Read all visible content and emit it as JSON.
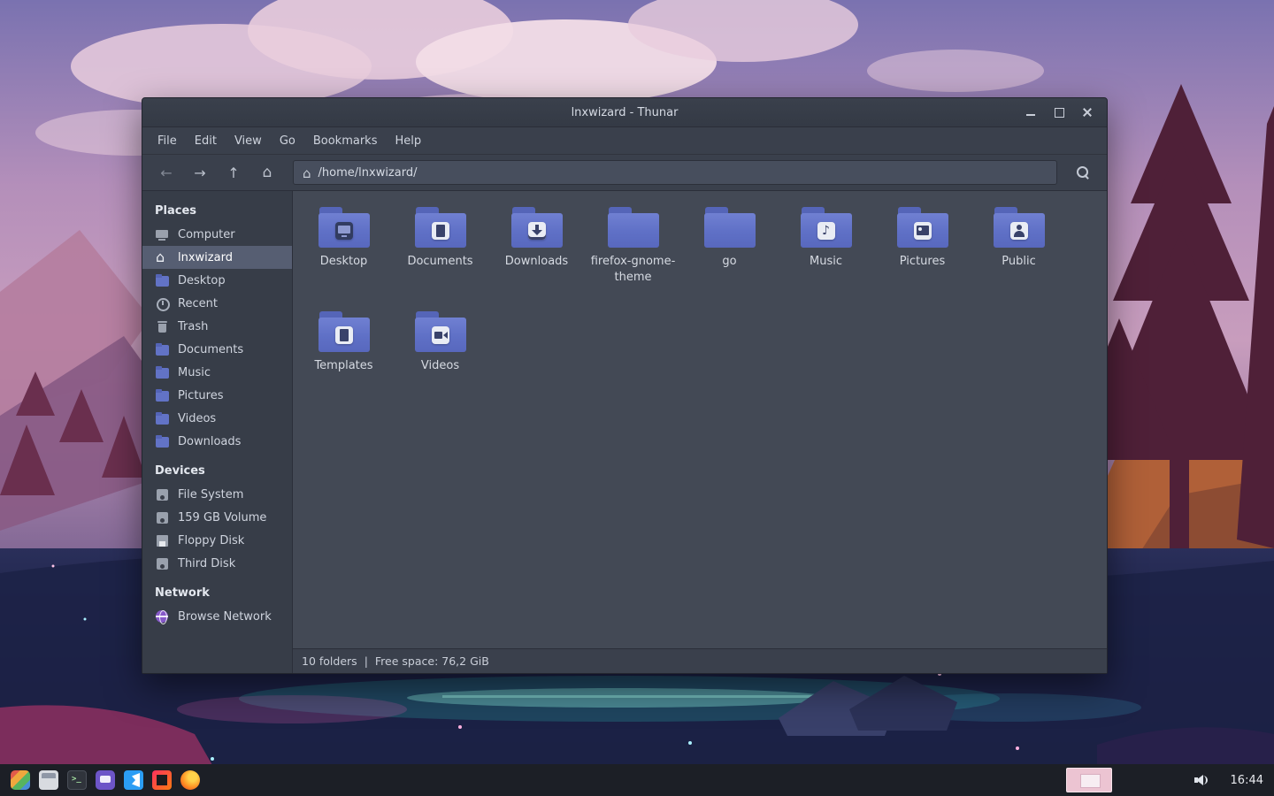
{
  "colors": {
    "folder_blue": "#6273c6",
    "sidebar_selection": "#565e72",
    "taskbar_active_button": "#ecc4d2"
  },
  "window": {
    "title": "lnxwizard - Thunar",
    "menu_items": [
      "File",
      "Edit",
      "View",
      "Go",
      "Bookmarks",
      "Help"
    ],
    "toolbar": {
      "path": "/home/lnxwizard/"
    },
    "statusbar": {
      "folders": "10 folders",
      "separator": "|",
      "free_space": "Free space: 76,2 GiB"
    }
  },
  "sidebar": {
    "sections": [
      {
        "label": "Places",
        "items": [
          {
            "label": "Computer",
            "icon": "computer",
            "selected": false
          },
          {
            "label": "lnxwizard",
            "icon": "home",
            "selected": true
          },
          {
            "label": "Desktop",
            "icon": "desktop",
            "selected": false
          },
          {
            "label": "Recent",
            "icon": "recent",
            "selected": false
          },
          {
            "label": "Trash",
            "icon": "trash",
            "selected": false
          },
          {
            "label": "Documents",
            "icon": "documents",
            "selected": false
          },
          {
            "label": "Music",
            "icon": "music",
            "selected": false
          },
          {
            "label": "Pictures",
            "icon": "pictures",
            "selected": false
          },
          {
            "label": "Videos",
            "icon": "videos",
            "selected": false
          },
          {
            "label": "Downloads",
            "icon": "downloads",
            "selected": false
          }
        ]
      },
      {
        "label": "Devices",
        "items": [
          {
            "label": "File System",
            "icon": "drive",
            "selected": false
          },
          {
            "label": "159 GB Volume",
            "icon": "drive",
            "selected": false
          },
          {
            "label": "Floppy Disk",
            "icon": "floppy",
            "selected": false
          },
          {
            "label": "Third Disk",
            "icon": "drive",
            "selected": false
          }
        ]
      },
      {
        "label": "Network",
        "items": [
          {
            "label": "Browse Network",
            "icon": "network",
            "selected": false
          }
        ]
      }
    ]
  },
  "files": [
    {
      "name": "Desktop",
      "emblem": "desktop"
    },
    {
      "name": "Documents",
      "emblem": "page"
    },
    {
      "name": "Downloads",
      "emblem": "download"
    },
    {
      "name": "firefox-gnome-theme",
      "emblem": "none"
    },
    {
      "name": "go",
      "emblem": "none"
    },
    {
      "name": "Music",
      "emblem": "music"
    },
    {
      "name": "Pictures",
      "emblem": "picture"
    },
    {
      "name": "Public",
      "emblem": "person"
    },
    {
      "name": "Templates",
      "emblem": "page"
    },
    {
      "name": "Videos",
      "emblem": "camera"
    }
  ],
  "taskbar": {
    "apps": [
      {
        "name": "app-menu"
      },
      {
        "name": "file-manager"
      },
      {
        "name": "terminal"
      },
      {
        "name": "chat-app"
      },
      {
        "name": "vscode"
      },
      {
        "name": "intellij"
      },
      {
        "name": "firefox"
      }
    ],
    "clock": "16:44"
  }
}
